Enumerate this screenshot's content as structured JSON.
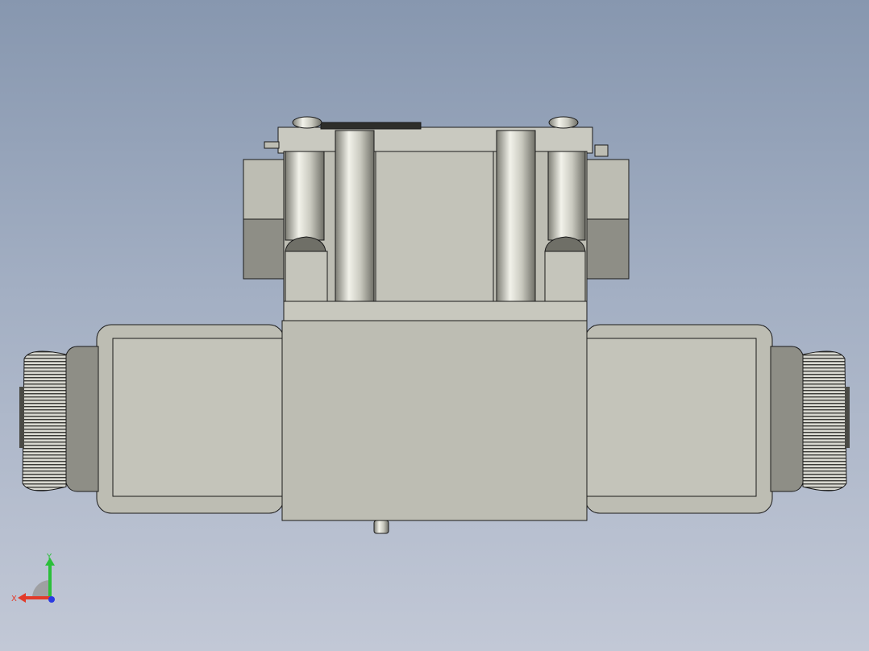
{
  "viewport": {
    "background_top": "#8797af",
    "background_bottom": "#c2c8d6"
  },
  "model": {
    "name": "solenoid-directional-valve",
    "body_color": "#bdbdb3",
    "shadow_color": "#8e8e86",
    "edge_color": "#1a1a1a"
  },
  "triad": {
    "x_label": "X",
    "y_label": "Y",
    "x_color": "#e23a2a",
    "y_color": "#2bbf3a",
    "z_color": "#2a3ae2"
  }
}
